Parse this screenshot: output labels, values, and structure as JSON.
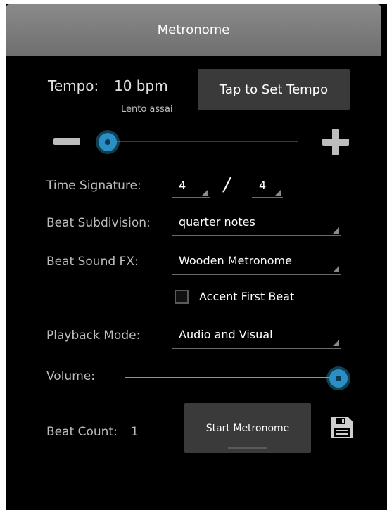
{
  "app": {
    "title": "Metronome"
  },
  "tempo": {
    "label": "Tempo:",
    "value": "10 bpm",
    "marking": "Lento assai",
    "tap_button": "Tap to Set Tempo",
    "slider_level": 0.0
  },
  "time_signature": {
    "label": "Time Signature:",
    "numerator": "4",
    "separator": "/",
    "denominator": "4"
  },
  "beat_subdivision": {
    "label": "Beat Subdivision:",
    "value": "quarter notes"
  },
  "beat_sound": {
    "label": "Beat Sound FX:",
    "value": "Wooden Metronome"
  },
  "accent": {
    "label": "Accent First Beat",
    "checked": false
  },
  "playback_mode": {
    "label": "Playback Mode:",
    "value": "Audio and Visual"
  },
  "volume": {
    "label": "Volume:",
    "level": 1.0
  },
  "beat_count": {
    "label": "Beat Count:",
    "value": "1"
  },
  "start_button": {
    "label": "Start Metronome"
  },
  "colors": {
    "accent": "#33b5e5",
    "background": "#000000",
    "titlebar": "#7a7a7a"
  },
  "icons": {
    "minus": "minus-icon",
    "plus": "plus-icon",
    "save": "save-icon"
  }
}
